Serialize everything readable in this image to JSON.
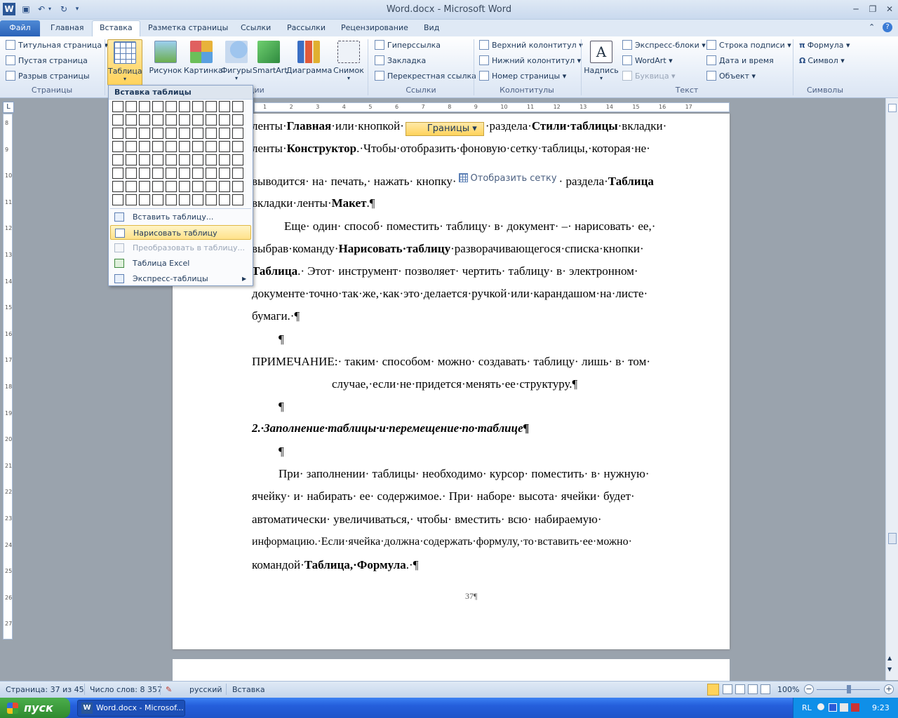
{
  "window": {
    "title": "Word.docx  -  Microsoft Word"
  },
  "tabs": [
    "Файл",
    "Главная",
    "Вставка",
    "Разметка страницы",
    "Ссылки",
    "Рассылки",
    "Рецензирование",
    "Вид"
  ],
  "ribbon": {
    "pages": {
      "label": "Страницы",
      "items": [
        "Титульная страница",
        "Пустая страница",
        "Разрыв страницы"
      ]
    },
    "illustrations": {
      "label": "Иллюстрации",
      "table": "Таблица",
      "picture": "Рисунок",
      "clipart": "Картинка",
      "shapes": "Фигуры",
      "smartart": "SmartArt",
      "chart": "Диаграмма",
      "screenshot": "Снимок"
    },
    "links": {
      "label": "Ссылки",
      "items": [
        "Гиперссылка",
        "Закладка",
        "Перекрестная ссылка"
      ]
    },
    "headers": {
      "label": "Колонтитулы",
      "items": [
        "Верхний колонтитул",
        "Нижний колонтитул",
        "Номер страницы"
      ]
    },
    "text": {
      "label": "Текст",
      "textbox": "Надпись",
      "items": [
        "Экспресс-блоки",
        "WordArt",
        "Буквица"
      ],
      "items2": [
        "Строка подписи",
        "Дата и время",
        "Объект"
      ]
    },
    "symbols": {
      "label": "Символы",
      "items": [
        "Формула",
        "Символ"
      ]
    }
  },
  "dropdown": {
    "header": "Вставка таблицы",
    "items": [
      "Вставить таблицу...",
      "Нарисовать таблицу",
      "Преобразовать в таблицу...",
      "Таблица Excel",
      "Экспресс-таблицы"
    ]
  },
  "ruler": {
    "h_numbers": [
      "1",
      "2",
      "3",
      "4",
      "5",
      "6",
      "7",
      "8",
      "9",
      "10",
      "11",
      "12",
      "13",
      "14",
      "15",
      "16",
      "17"
    ],
    "v_numbers": [
      "8",
      "9",
      "10",
      "11",
      "12",
      "13",
      "14",
      "15",
      "16",
      "17",
      "18",
      "19",
      "20",
      "21",
      "22",
      "23",
      "24",
      "25",
      "26",
      "27"
    ]
  },
  "document": {
    "inline_button_borders": "Границы",
    "inline_button_grid": "Отобразить сетку",
    "l1a": "ленты·",
    "l1b": "Главная",
    "l1c": "·или·кнопкой·",
    "l1d": "·раздела·",
    "l1e": "Стили·таблицы",
    "l1f": "·вкладки·",
    "l2a": "ленты·",
    "l2b": "Конструктор",
    "l2c": ".·Чтобы·отобразить·фоновую·сетку·таблицы,·которая·не·",
    "l3a": "выводится· на· печать,· нажать· кнопку·",
    "l3b": "· раздела·",
    "l3c": "Таблица",
    "l4a": "вкладки·ленты·",
    "l4b": "Макет",
    "l4c": ".¶",
    "p2l1": "Еще· один· способ· поместить· таблицу· в· документ· –· нарисовать· ее,·",
    "p2l2a": "выбрав·команду·",
    "p2l2b": "Нарисовать·таблицу",
    "p2l2c": "·разворачивающегося·списка·кнопки·",
    "p2l3a": "Таблица",
    "p2l3b": ".· Этот· инструмент· позволяет· чертить· таблицу· в· электронном·",
    "p2l4": "документе·точно·так·же,·как·это·делается·ручкой·или·карандашом·на·листе·",
    "p2l5": "бумаги.·¶",
    "pil1": "¶",
    "note1": "ПРИМЕЧАНИЕ:· таким· способом· можно· создавать· таблицу· лишь· в· том·",
    "note2": "случае,·если·не·придется·менять·ее·структуру.¶",
    "pil2": "¶",
    "heading": "2.·Заполнение·таблицы·и·перемещение·по·таблице¶",
    "pil3": "¶",
    "p3l1": "При· заполнении· таблицы· необходимо· курсор· поместить· в· нужную·",
    "p3l2": "ячейку· и· набирать· ее· содержимое.· При· наборе· высота· ячейки· будет·",
    "p3l3": "автоматически·  увеличиваться,·  чтобы·  вместить·  всю·  набираемую·",
    "p3l4": "информацию.·Если·ячейка·должна·содержать·формулу,·то·вставить·ее·можно·",
    "p3l5a": "командой·",
    "p3l5b": "Таблица,·Формула",
    "p3l5c": ".·¶",
    "pagenum": "37¶"
  },
  "statusbar": {
    "page": "Страница: 37 из 45",
    "words": "Число слов: 8 357",
    "lang": "русский",
    "mode": "Вставка",
    "zoom": "100%"
  },
  "taskbar": {
    "start": "пуск",
    "item": "Word.docx - Microsof...",
    "lang": "RL",
    "time": "9:23"
  }
}
